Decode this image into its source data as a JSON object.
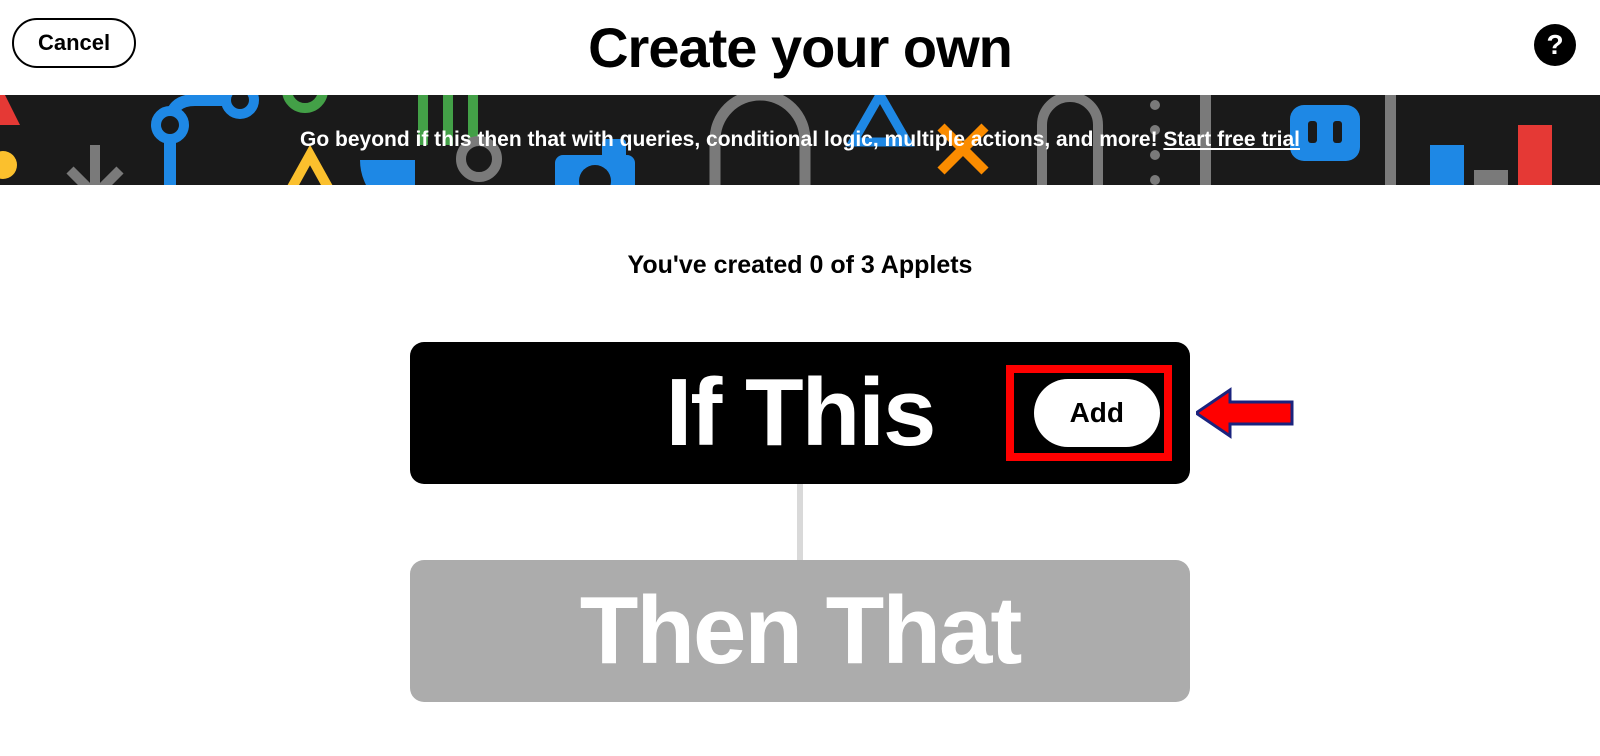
{
  "header": {
    "cancel_label": "Cancel",
    "title": "Create your own"
  },
  "promo": {
    "text_before": "Go beyond if this then that with queries, conditional logic, multiple actions, and more! ",
    "link_text": "Start free trial"
  },
  "counter": {
    "text": "You've created 0 of 3 Applets"
  },
  "cards": {
    "if_this_label": "If This",
    "add_label": "Add",
    "then_that_label": "Then That"
  }
}
